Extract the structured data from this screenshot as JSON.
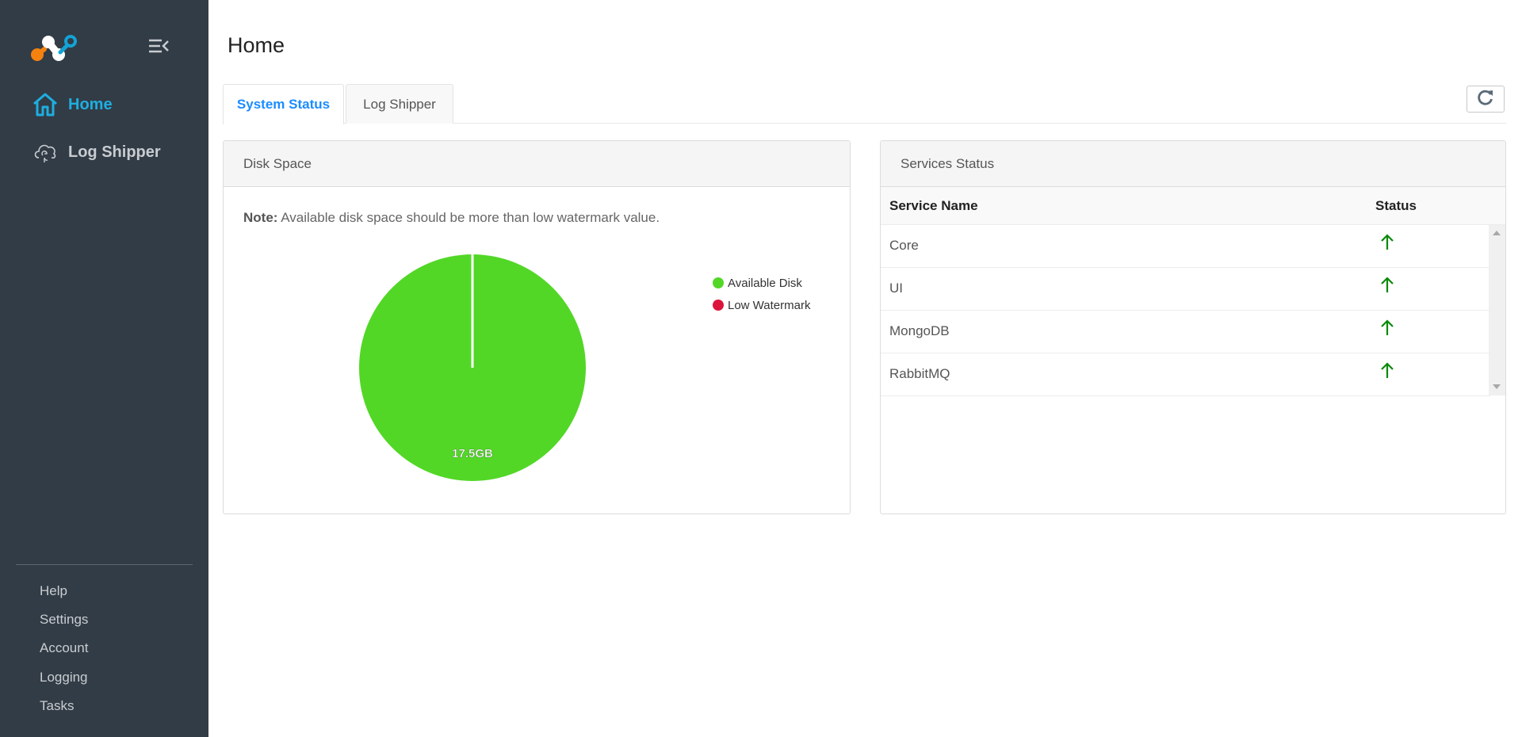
{
  "sidebar": {
    "nav": [
      {
        "label": "Home",
        "icon": "home-icon",
        "active": true
      },
      {
        "label": "Log Shipper",
        "icon": "cloud-sync-icon",
        "active": false
      }
    ],
    "bottom_items": [
      "Help",
      "Settings",
      "Account",
      "Logging",
      "Tasks"
    ]
  },
  "header": {
    "title": "Home"
  },
  "tabs": [
    {
      "label": "System Status",
      "active": true
    },
    {
      "label": "Log Shipper",
      "active": false
    }
  ],
  "disk_panel": {
    "title": "Disk Space",
    "note_label": "Note:",
    "note_text": " Available disk space should be more than low watermark value."
  },
  "services_panel": {
    "title": "Services Status",
    "columns": [
      "Service Name",
      "Status"
    ],
    "rows": [
      {
        "name": "Core",
        "status": "up"
      },
      {
        "name": "UI",
        "status": "up"
      },
      {
        "name": "MongoDB",
        "status": "up"
      },
      {
        "name": "RabbitMQ",
        "status": "up"
      }
    ],
    "status_color": "#0a8a0a"
  },
  "colors": {
    "accent": "#1eaee0",
    "tab_active": "#1a8cff",
    "sidebar_bg": "#323c46"
  },
  "chart_data": {
    "type": "pie",
    "title": "Disk Space",
    "series": [
      {
        "name": "Available Disk",
        "value": 17.5,
        "label": "17.5GB",
        "color": "#52d726"
      },
      {
        "name": "Low Watermark",
        "value": 0,
        "label": "",
        "color": "#dc143c"
      }
    ],
    "unit": "GB",
    "legend": "right"
  }
}
